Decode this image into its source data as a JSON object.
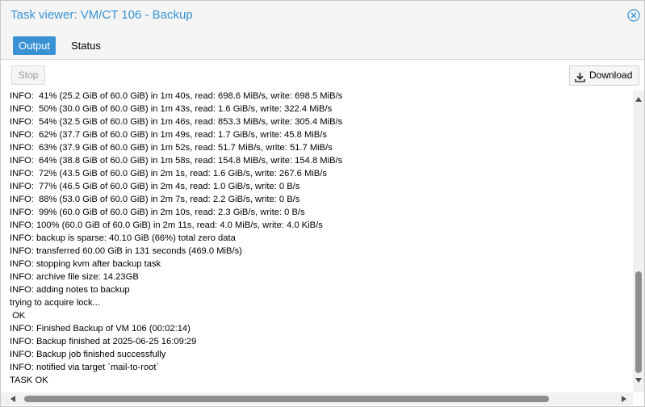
{
  "window": {
    "title": "Task viewer: VM/CT 106 - Backup"
  },
  "tabs": [
    {
      "label": "Output",
      "active": true
    },
    {
      "label": "Status",
      "active": false
    }
  ],
  "toolbar": {
    "stop_label": "Stop",
    "stop_enabled": false,
    "download_label": "Download"
  },
  "log": {
    "lines": [
      "INFO:  41% (25.2 GiB of 60.0 GiB) in 1m 40s, read: 698.6 MiB/s, write: 698.5 MiB/s",
      "INFO:  50% (30.0 GiB of 60.0 GiB) in 1m 43s, read: 1.6 GiB/s, write: 322.4 MiB/s",
      "INFO:  54% (32.5 GiB of 60.0 GiB) in 1m 46s, read: 853.3 MiB/s, write: 305.4 MiB/s",
      "INFO:  62% (37.7 GiB of 60.0 GiB) in 1m 49s, read: 1.7 GiB/s, write: 45.8 MiB/s",
      "INFO:  63% (37.9 GiB of 60.0 GiB) in 1m 52s, read: 51.7 MiB/s, write: 51.7 MiB/s",
      "INFO:  64% (38.8 GiB of 60.0 GiB) in 1m 58s, read: 154.8 MiB/s, write: 154.8 MiB/s",
      "INFO:  72% (43.5 GiB of 60.0 GiB) in 2m 1s, read: 1.6 GiB/s, write: 267.6 MiB/s",
      "INFO:  77% (46.5 GiB of 60.0 GiB) in 2m 4s, read: 1.0 GiB/s, write: 0 B/s",
      "INFO:  88% (53.0 GiB of 60.0 GiB) in 2m 7s, read: 2.2 GiB/s, write: 0 B/s",
      "INFO:  99% (60.0 GiB of 60.0 GiB) in 2m 10s, read: 2.3 GiB/s, write: 0 B/s",
      "INFO: 100% (60.0 GiB of 60.0 GiB) in 2m 11s, read: 4.0 MiB/s, write: 4.0 KiB/s",
      "INFO: backup is sparse: 40.10 GiB (66%) total zero data",
      "INFO: transferred 60.00 GiB in 131 seconds (469.0 MiB/s)",
      "INFO: stopping kvm after backup task",
      "INFO: archive file size: 14.23GB",
      "INFO: adding notes to backup",
      "trying to acquire lock...",
      " OK",
      "INFO: Finished Backup of VM 106 (00:02:14)",
      "INFO: Backup finished at 2025-06-25 16:09:29",
      "INFO: Backup job finished successfully",
      "INFO: notified via target `mail-to-root`",
      "TASK OK"
    ]
  },
  "icons": {
    "close": "close-circle-icon",
    "download": "download-icon"
  },
  "colors": {
    "accent": "#3892d4",
    "title_text": "#3892d4",
    "active_tab_bg": "#3892d4"
  }
}
